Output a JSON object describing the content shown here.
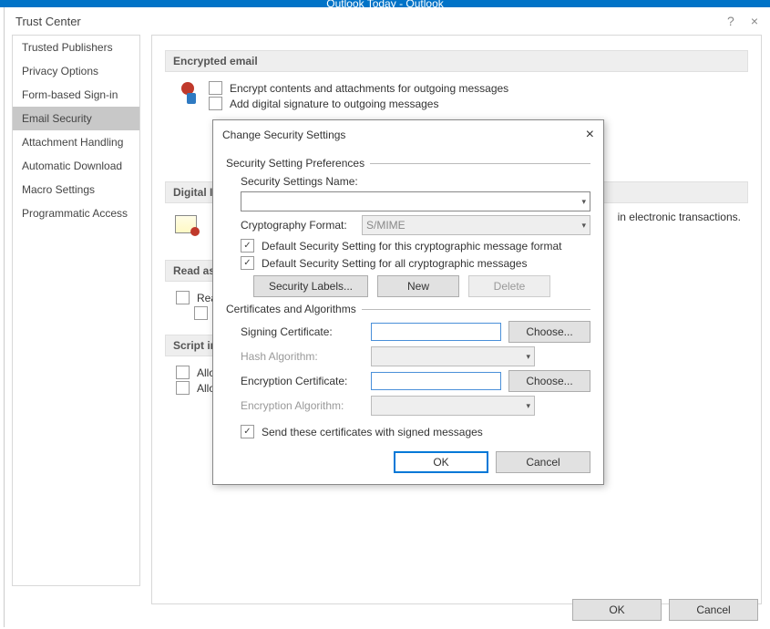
{
  "titlebar": "Outlook Today - Outlook",
  "windowTitle": "Trust Center",
  "helpGlyph": "?",
  "closeGlyph": "×",
  "sidebar": [
    "Trusted Publishers",
    "Privacy Options",
    "Form-based Sign-in",
    "Email Security",
    "Attachment Handling",
    "Automatic Download",
    "Macro Settings",
    "Programmatic Access"
  ],
  "sections": {
    "encrypted": "Encrypted email",
    "encryptOpt1": "Encrypt contents and attachments for outgoing messages",
    "encryptOpt2": "Add digital signature to outgoing messages",
    "digitalId": "Digital ID",
    "digitalIdText": "in electronic transactions.",
    "readAs": "Read as",
    "readAsChk": "Rea",
    "scriptIn": "Script in",
    "scriptChk1": "Allo",
    "scriptChk2": "Allo"
  },
  "footer": {
    "ok": "OK",
    "cancel": "Cancel"
  },
  "dialog": {
    "title": "Change Security Settings",
    "group1": "Security Setting Preferences",
    "settingsName": "Security Settings Name:",
    "cryptoFormat": "Cryptography Format:",
    "cryptoValue": "S/MIME",
    "defaultFormat": "Default Security Setting for this cryptographic message format",
    "defaultAll": "Default Security Setting for all cryptographic messages",
    "btnSecLabels": "Security Labels...",
    "btnNew": "New",
    "btnDelete": "Delete",
    "group2": "Certificates and Algorithms",
    "signingCert": "Signing Certificate:",
    "hashAlg": "Hash Algorithm:",
    "encCert": "Encryption Certificate:",
    "encAlg": "Encryption Algorithm:",
    "choose": "Choose...",
    "sendCerts": "Send these certificates with signed messages",
    "ok": "OK",
    "cancel": "Cancel"
  }
}
